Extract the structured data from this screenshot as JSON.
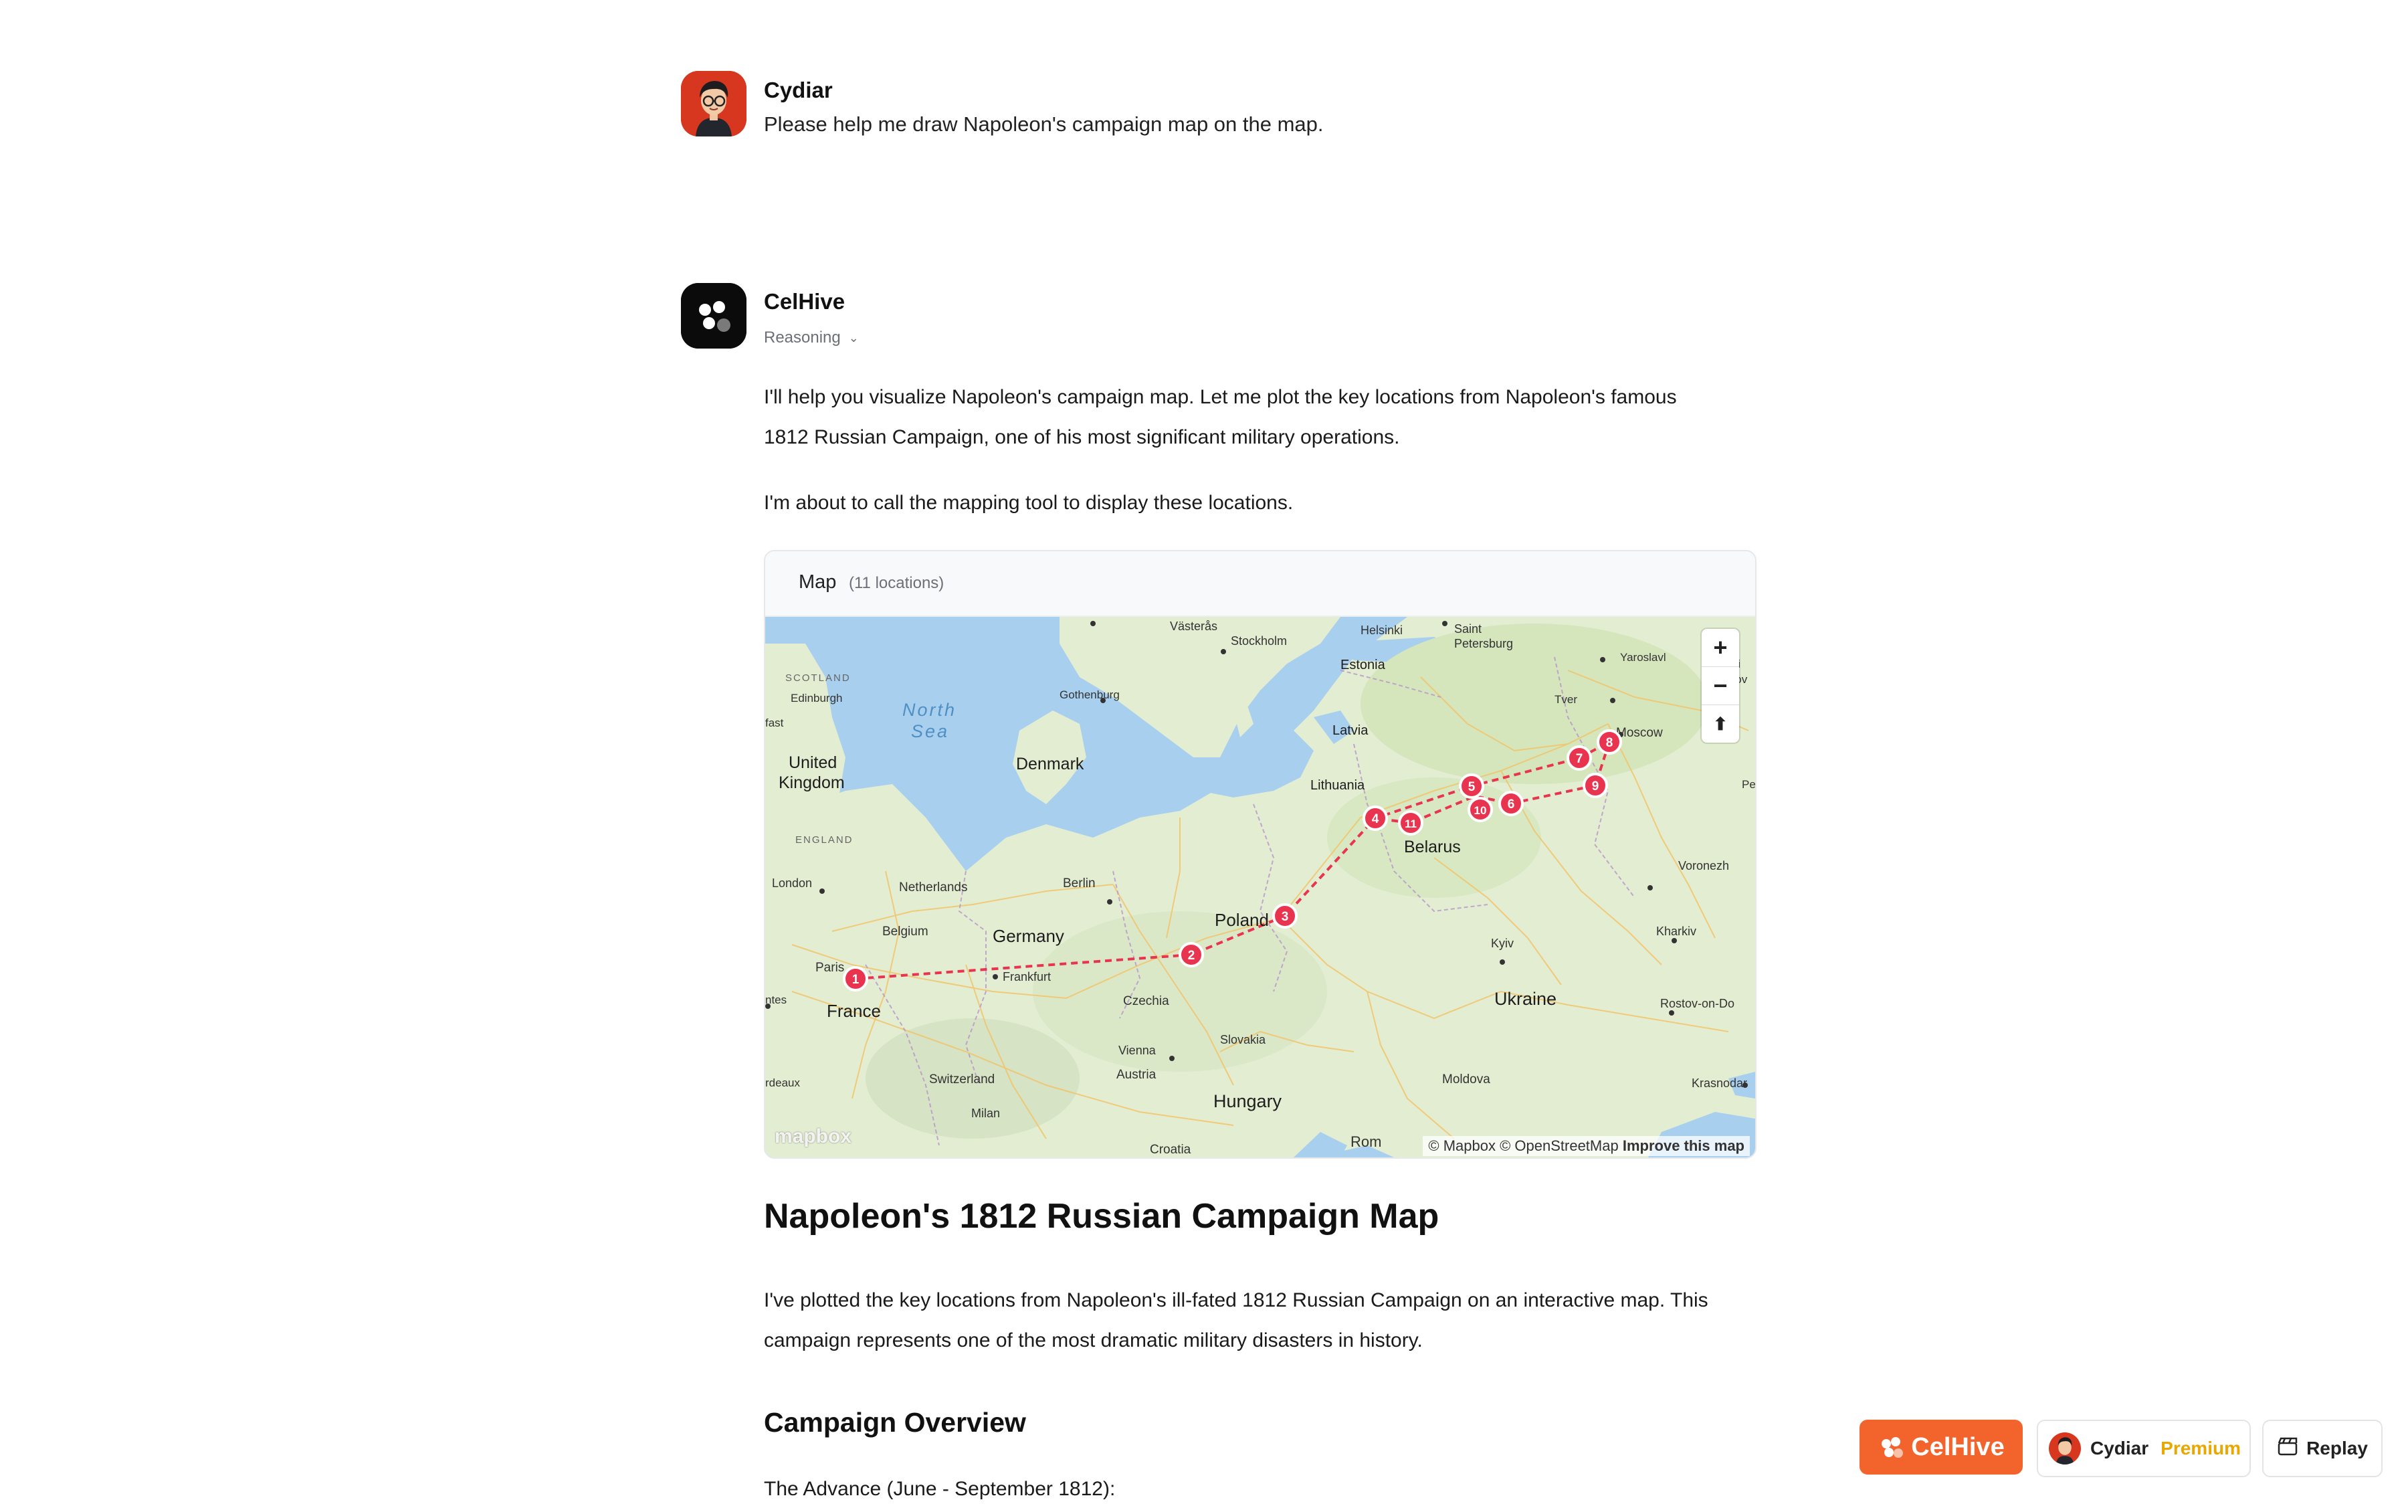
{
  "user_message": {
    "name": "Cydiar",
    "text": "Please help me draw Napoleon's campaign map on the map."
  },
  "assistant": {
    "name": "CelHive",
    "reasoning_label": "Reasoning",
    "intro_1": "I'll help you visualize Napoleon's campaign map. Let me plot the key locations from Napoleon's famous",
    "intro_2": "1812 Russian Campaign, one of his most significant military operations.",
    "intro_3": "I'm about to call the mapping tool to display these locations.",
    "heading": "Napoleon's 1812 Russian Campaign Map",
    "body_1": "I've plotted the key locations from Napoleon's ill-fated 1812 Russian Campaign on an interactive map. This",
    "body_2": "campaign represents one of the most dramatic military disasters in history.",
    "subheading": "Campaign Overview",
    "advance": "The Advance (June - September 1812):"
  },
  "map": {
    "title": "Map",
    "count": "(11 locations)",
    "zoom_in": "+",
    "zoom_out": "−",
    "compass": "⬆",
    "logo": "mapbox",
    "attribution": "© Mapbox © OpenStreetMap",
    "improve": "Improve this map",
    "markers": [
      "1",
      "2",
      "3",
      "4",
      "5",
      "6",
      "7",
      "8",
      "9",
      "10",
      "11"
    ],
    "labels": {
      "vasteras": "Västerås",
      "stockholm": "Stockholm",
      "helsinki": "Helsinki",
      "saint_petersburg_1": "Saint",
      "saint_petersburg_2": "Petersburg",
      "yaroslavl": "Yaroslavl",
      "ni": "Ni",
      "nov": "Nov",
      "tver": "Tver",
      "moscow": "Moscow",
      "estonia": "Estonia",
      "latvia": "Latvia",
      "lithuania": "Lithuania",
      "belarus": "Belarus",
      "scotland": "SCOTLAND",
      "edinburgh": "Edinburgh",
      "north": "North",
      "sea": "Sea",
      "gothenburg": "Gothenburg",
      "denmark": "Denmark",
      "uk_1": "United",
      "uk_2": "Kingdom",
      "fast": "fast",
      "england": "ENGLAND",
      "london": "London",
      "netherlands": "Netherlands",
      "berlin": "Berlin",
      "belgium": "Belgium",
      "germany": "Germany",
      "paris": "Paris",
      "frankfurt": "Frankfurt",
      "poland": "Poland",
      "kyiv": "Kyiv",
      "ukraine": "Ukraine",
      "kharkiv": "Kharkiv",
      "voronezh": "Voronezh",
      "rostov": "Rostov-on-Do",
      "pe": "Pe",
      "ntes": "ntes",
      "france": "France",
      "czechia": "Czechia",
      "slovakia": "Slovakia",
      "vienna": "Vienna",
      "austria": "Austria",
      "switzerland": "Switzerland",
      "rdeaux": "rdeaux",
      "milan": "Milan",
      "hungary": "Hungary",
      "moldova": "Moldova",
      "krasnodar": "Krasnodar",
      "croatia": "Croatia",
      "rom": "Rom"
    }
  },
  "bottom_bar": {
    "brand": "CelHive",
    "user": "Cydiar",
    "plan": "Premium",
    "replay": "Replay"
  },
  "colors": {
    "marker": "#e8344e",
    "brand": "#f2642c",
    "premium": "#e8a800",
    "water": "#a8cfee",
    "land": "#e3edd2"
  }
}
